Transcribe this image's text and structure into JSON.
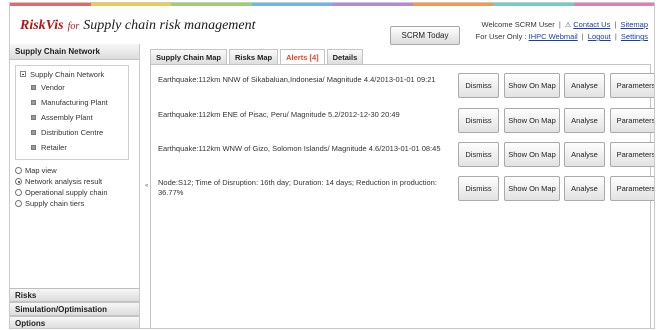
{
  "header": {
    "brand_name": "RiskVis",
    "brand_for": "for",
    "brand_subtitle": "Supply chain risk management",
    "scrm_today_label": "SCRM Today",
    "welcome_text": "Welcome SCRM User",
    "contact_label": "Contact Us",
    "sitemap_label": "Sitemap",
    "user_only_text": "For User Only :",
    "webmail_label": "IHPC Webmail",
    "logout_label": "Logout",
    "settings_label": "Settings"
  },
  "colors": {
    "accent_bar": [
      "#e06a6a",
      "#f2c94c",
      "#9bd06b",
      "#6fb6e8",
      "#b48ad8",
      "#f29a4a",
      "#6fd0c0",
      "#e07fb0"
    ],
    "brand_red": "#b01818",
    "alert_tab": "#e8432d",
    "link_blue": "#1a3fa8"
  },
  "sidebar": {
    "top_section_label": "Supply Chain Network",
    "tree_root_label": "Supply Chain Network",
    "tree_items": [
      {
        "label": "Vendor"
      },
      {
        "label": "Manufacturing Plant"
      },
      {
        "label": "Assembly Plant"
      },
      {
        "label": "Distribution Centre"
      },
      {
        "label": "Retailer"
      }
    ],
    "views": [
      {
        "label": "Map view",
        "selected": false
      },
      {
        "label": "Network analysis result",
        "selected": true
      },
      {
        "label": "Operational supply chain",
        "selected": false
      },
      {
        "label": "Supply chain tiers",
        "selected": false
      }
    ],
    "bottom_sections": [
      {
        "label": "Risks"
      },
      {
        "label": "Simulation/Optimisation"
      },
      {
        "label": "Options"
      }
    ]
  },
  "tabs": [
    {
      "label": "Supply Chain Map"
    },
    {
      "label": "Risks Map"
    },
    {
      "label": "Alerts [4]"
    },
    {
      "label": "Details"
    }
  ],
  "alerts": [
    {
      "text": "Earthquake:112km NNW of Sikabaluan,Indonesia/ Magnitude 4.4/2013-01-01 09:21"
    },
    {
      "text": "Earthquake:112km ENE of Pisac, Peru/ Magnitude 5.2/2012-12-30 20:49"
    },
    {
      "text": "Earthquake:112km WNW of Gizo, Solomon Islands/ Magnitude 4.6/2013-01-01 08:45"
    },
    {
      "text": "Node:S12; Time of Disruption: 16th day; Duration: 14 days; Reduction in production: 36.77%"
    }
  ],
  "actions": {
    "dismiss_label": "Dismiss",
    "show_on_map_label": "Show On Map",
    "analyse_label": "Analyse",
    "parameters_label": "Parameters"
  },
  "splitter_glyph": "«"
}
